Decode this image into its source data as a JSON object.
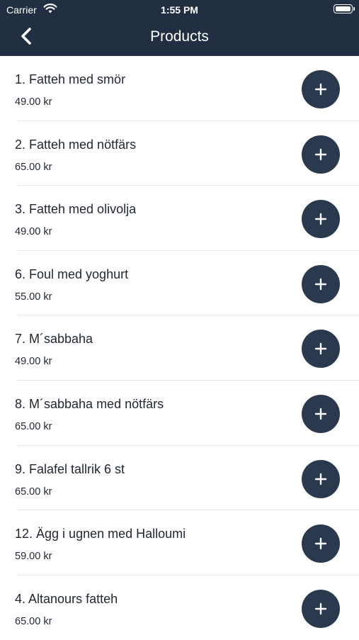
{
  "status_bar": {
    "carrier": "Carrier",
    "time": "1:55 PM",
    "wifi_icon": "wifi-icon",
    "battery_icon": "battery-icon"
  },
  "nav": {
    "title": "Products",
    "back_icon": "chevron-left-icon",
    "background_color": "#222f43"
  },
  "products": [
    {
      "name": "1. Fatteh med smör",
      "price": "49.00 kr"
    },
    {
      "name": "2. Fatteh med nötfärs",
      "price": "65.00 kr"
    },
    {
      "name": "3. Fatteh med olivolja",
      "price": "49.00 kr"
    },
    {
      "name": "6. Foul med yoghurt",
      "price": "55.00 kr"
    },
    {
      "name": "7. M´sabbaha",
      "price": "49.00 kr"
    },
    {
      "name": "8. M´sabbaha med nötfärs",
      "price": "65.00 kr"
    },
    {
      "name": "9. Falafel tallrik 6 st",
      "price": "65.00 kr"
    },
    {
      "name": "12. Ägg i ugnen med Halloumi",
      "price": "59.00 kr"
    },
    {
      "name": "4. Altanours fatteh",
      "price": "65.00 kr"
    }
  ],
  "add_button": {
    "icon": "plus-icon",
    "color": "#2b394f"
  }
}
